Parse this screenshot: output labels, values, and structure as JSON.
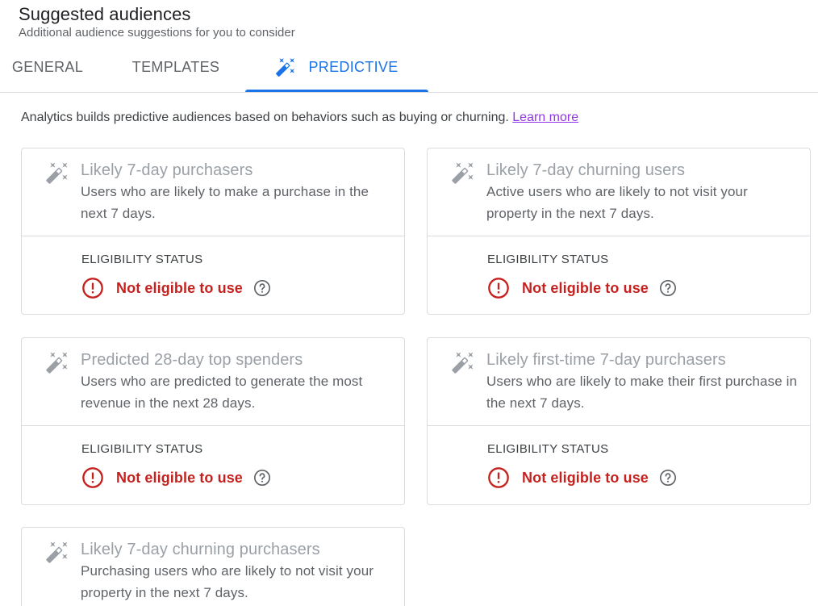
{
  "header": {
    "title": "Suggested audiences",
    "subtitle": "Additional audience suggestions for you to consider"
  },
  "tabs": [
    {
      "label": "GENERAL",
      "active": false
    },
    {
      "label": "TEMPLATES",
      "active": false
    },
    {
      "label": "PREDICTIVE",
      "active": true,
      "icon": "magic-wand-icon"
    }
  ],
  "intro": {
    "text": "Analytics builds predictive audiences based on behaviors such as buying or churning.",
    "link": "Learn more"
  },
  "colors": {
    "accent": "#1a73e8",
    "error": "#c5221f",
    "link": "#9334e6",
    "border": "#dadce0"
  },
  "cards": [
    {
      "title": "Likely 7-day purchasers",
      "description": "Users who are likely to make a purchase in the next 7 days.",
      "eligibility_label": "ELIGIBILITY STATUS",
      "status": "Not eligible to use"
    },
    {
      "title": "Likely 7-day churning users",
      "description": "Active users who are likely to not visit your property in the next 7 days.",
      "eligibility_label": "ELIGIBILITY STATUS",
      "status": "Not eligible to use"
    },
    {
      "title": "Predicted 28-day top spenders",
      "description": "Users who are predicted to generate the most revenue in the next 28 days.",
      "eligibility_label": "ELIGIBILITY STATUS",
      "status": "Not eligible to use"
    },
    {
      "title": "Likely first-time 7-day purchasers",
      "description": "Users who are likely to make their first purchase in the next 7 days.",
      "eligibility_label": "ELIGIBILITY STATUS",
      "status": "Not eligible to use"
    },
    {
      "title": "Likely 7-day churning purchasers",
      "description": "Purchasing users who are likely to not visit your property in the next 7 days."
    }
  ]
}
